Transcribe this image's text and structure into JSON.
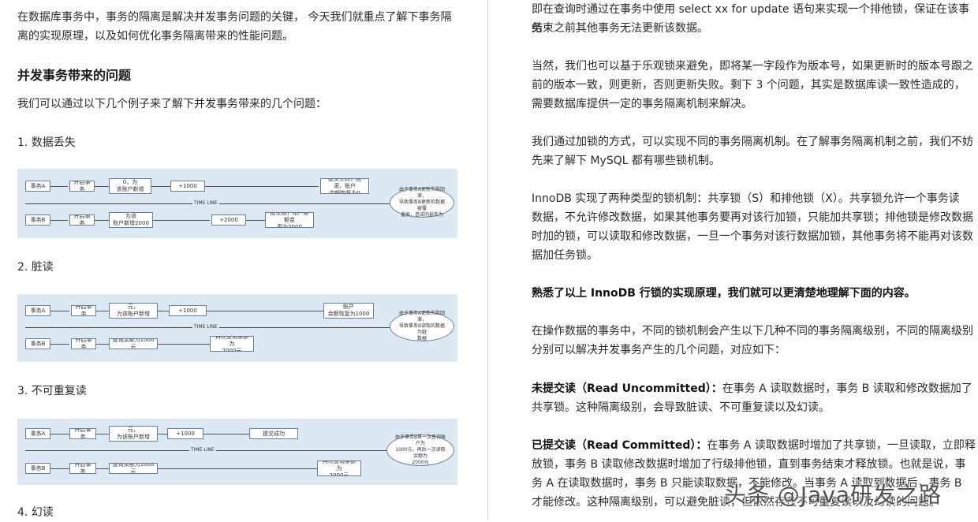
{
  "left": {
    "intro_line1": "在数据库事务中，事务的隔离是解决并发事务问题的关键， 今天我们就重点了解下事务隔",
    "intro_line2": "离的实现原理，以及如何优化事务隔离带来的性能问题。",
    "heading": "并发事务带来的问题",
    "lead": "我们可以通过以下几个例子来了解下并发事务带来的几个问题：",
    "item1": "1. 数据丢失",
    "item2": "2. 脏读",
    "item3": "3. 不可重复读",
    "item4": "4. 幻读"
  },
  "diagrams": {
    "timeline": "TIME LINE",
    "d1": {
      "a": "事务A",
      "a_open": "开启事务",
      "a_read": "账户余额为0，为\n该账户新增1000元",
      "a_add": "+1000",
      "a_fail": "提交失败，回滚，账户\n余额恢复为0",
      "b": "事务B",
      "b_open": "开启事务",
      "b_read": "账户余额为0，为该\n账户新增2000元",
      "b_add": "+2000",
      "b_commit": "提交后，账户余额变\n更为2000",
      "cloud": "由于事务A更新失败回滚，\n导致事务B更新的数据被覆\n盖掉，造成的损失为"
    },
    "d2": {
      "a": "事务A",
      "a_open": "开启事务",
      "a_read": "账户余额为1000元，\n为该账户新增1000元",
      "a_add": "+1000",
      "a_fail": "提交失败，回滚，账户\n余额恢复为1000元",
      "b": "事务B",
      "b_open": "开启事务",
      "b_read": "查询余额为1000元",
      "b_result": "再次查询余额为\n2000元",
      "cloud": "由于事务A更新失败回滚，\n导致事务B读取的数据为脏\n数据"
    },
    "d3": {
      "a": "事务A",
      "a_open": "开启事务",
      "a_read": "账户余额为1000元，\n为该账户新增1000元",
      "a_add": "+1000",
      "a_commit": "提交成功",
      "b": "事务B",
      "b_open": "开启事务",
      "b_read": "查询余额为1000元",
      "b_result": "再次查询余额为\n2000元",
      "cloud": "由于事务B第一次查询账户为\n1000元，再后一次读取余额为\n2000元"
    }
  },
  "right": {
    "p1_l1": "即在查询时通过在事务中使用 select xx for update 语句来实现一个排他锁，保证在该事务",
    "p1_l2": "结束之前其他事务无法更新该数据。",
    "p2_l1": "当然，我们也可以基于乐观锁来避免，即将某一字段作为版本号，如果更新时的版本号跟之",
    "p2_l2": "前的版本一致，则更新，否则更新失败。剩下 3 个问题，其实是数据库读一致性造成的，",
    "p2_l3": "需要数据库提供一定的事务隔离机制来解决。",
    "p3_l1": "我们通过加锁的方式，可以实现不同的事务隔离机制。在了解事务隔离机制之前，我们不妨",
    "p3_l2": "先来了解下 MySQL 都有哪些锁机制。",
    "p4_l1": "InnoDB 实现了两种类型的锁机制：共享锁（S）和排他锁（X）。共享锁允许一个事务读",
    "p4_l2": "数据，不允许修改数据，如果其他事务要再对该行加锁，只能加共享锁；排他锁是修改数据",
    "p4_l3": "时加的锁，可以读取和修改数据，一旦一个事务对该行数据加锁，其他事务将不能再对该数",
    "p4_l4": "据加任务锁。",
    "p5": "熟悉了以上 InnoDB 行锁的实现原理，我们就可以更清楚地理解下面的内容。",
    "p6_l1": "在操作数据的事务中，不同的锁机制会产生以下几种不同的事务隔离级别，不同的隔离级别",
    "p6_l2": "分别可以解决并发事务产生的几个问题，对应如下：",
    "p7_bold": "未提交读（Read Uncommitted）：",
    "p7_l1": "在事务 A 读取数据时，事务 B 读取和修改数据加了",
    "p7_l2": "共享锁。这种隔离级别，会导致脏读、不可重复读以及幻读。",
    "p8_bold": "已提交读（Read Committed）：",
    "p8_l1": "在事务 A 读取数据时增加了共享锁，一旦读取，立即释",
    "p8_l2": "放锁，事务 B 读取修改数据时增加了行级排他锁，直到事务结束才释放锁。也就是说，事",
    "p8_l3": "务 A 在读取数据时，事务 B 只能读取数据，不能修改。当事务 A 读取到数据后，事务 B",
    "p8_l4": "才能修改。这种隔离级别，可以避免脏读，但依然存在不可重复读以及幻读的问题。"
  },
  "watermark": "头条 @Java研发之路"
}
